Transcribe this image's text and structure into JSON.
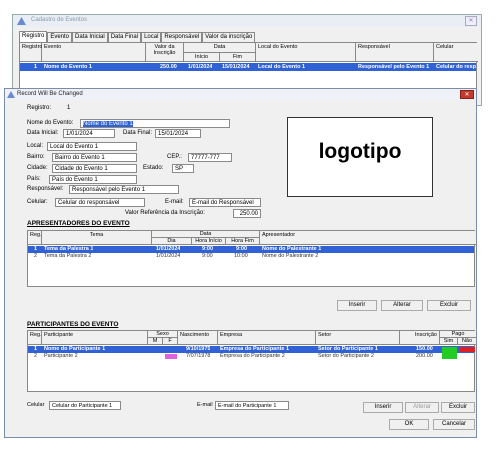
{
  "back_window": {
    "title": "Cadastro de Eventos",
    "tabs": [
      "Registro",
      "Evento",
      "Data Inicial",
      "Data Final",
      "Local",
      "Responsável",
      "Valor da inscrição"
    ],
    "columns": {
      "registro": "Registro",
      "evento": "Evento",
      "valor": "Valor da Inscrição",
      "data": "Data",
      "inicio": "Início",
      "fim": "Fim",
      "local": "Local do Evento",
      "responsavel": "Responsável",
      "celular": "Celular"
    },
    "row": {
      "registro": "1",
      "evento": "Nome do Evento 1",
      "valor": "250.00",
      "inicio": "1/01/2024",
      "fim": "15/01/2024",
      "local": "Local do Evento 1",
      "responsavel": "Responsável pelo Evento 1",
      "celular": "Celular do resp"
    }
  },
  "dialog": {
    "title": "Record Will Be Changed",
    "registro": {
      "label": "Registro:",
      "value": "1"
    },
    "nome": {
      "label": "Nome do Evento:",
      "value": "Nome do Evento 1"
    },
    "data_inicial": {
      "label": "Data Inicial:",
      "value": "1/01/2024"
    },
    "data_final": {
      "label": "Data Final:",
      "value": "15/01/2024"
    },
    "local": {
      "label": "Local:",
      "value": "Local do Evento 1"
    },
    "bairro": {
      "label": "Bairro:",
      "value": "Bairro do Evento 1"
    },
    "cep": {
      "label": "CEP.:",
      "value": "77777-777"
    },
    "cidade": {
      "label": "Cidade:",
      "value": "Cidade do Evento 1"
    },
    "estado": {
      "label": "Estado:",
      "value": "SP"
    },
    "pais": {
      "label": "País:",
      "value": "País do Evento 1"
    },
    "responsavel": {
      "label": "Responsável:",
      "value": "Responsável pelo Evento 1"
    },
    "celular": {
      "label": "Celular:",
      "value": "Celular do responsável"
    },
    "email": {
      "label": "E-mail:",
      "value": "E-mail do Responsável"
    },
    "valor_ref": {
      "label": "Valor Referência da Inscrição:",
      "value": "250.00"
    },
    "logo": "logotipo",
    "apresentadores": {
      "title": "APRESENTADORES DO EVENTO",
      "columns": {
        "reg": "Reg.",
        "tema": "Tema",
        "data": "Data",
        "dia": "Dia",
        "hora_inicio": "Hora Início",
        "hora_fim": "Hora Fim",
        "apresentador": "Apresentador"
      },
      "rows": [
        {
          "reg": "1",
          "tema": "Tema da Palestra 1",
          "dia": "1/01/2024",
          "inicio": "9:00",
          "fim": "9:00",
          "apresentador": "Nome do Palestrante 1"
        },
        {
          "reg": "2",
          "tema": "Tema da Palestra 2",
          "dia": "1/01/2024",
          "inicio": "9:00",
          "fim": "10:00",
          "apresentador": "Nome do Palestrante 2"
        }
      ],
      "buttons": {
        "inserir": "Inserir",
        "alterar": "Alterar",
        "excluir": "Excluir"
      }
    },
    "participantes": {
      "title": "PARTICIPANTES DO EVENTO",
      "columns": {
        "reg": "Reg.",
        "participante": "Participante",
        "sexo": "Sexo",
        "m": "M",
        "f": "F",
        "nascimento": "Nascimento",
        "empresa": "Empresa",
        "setor": "Setor",
        "inscricao": "Inscrição",
        "pago": "Pago",
        "sim": "Sim",
        "nao": "Não"
      },
      "rows": [
        {
          "reg": "1",
          "participante": "Nome do Participante 1",
          "nascimento": "9/10/1975",
          "empresa": "Empresa do Participante 1",
          "setor": "Setor do Participante 1",
          "inscricao": "150.00"
        },
        {
          "reg": "2",
          "participante": "Participante 2",
          "nascimento": "7/07/1978",
          "empresa": "Empresa do Participante 2",
          "setor": "Setor do Participante 2",
          "inscricao": "200.00"
        }
      ],
      "celular_label": "Celular",
      "celular_value": "Celular do Participante 1",
      "email_label": "E-mail",
      "email_value": "E-mail do Participante 1",
      "buttons": {
        "inserir": "Inserir",
        "alterar": "Alterar",
        "excluir": "Excluir"
      }
    },
    "ok": "OK",
    "cancelar": "Cancelar"
  },
  "colors": {
    "selection": "#3062d6",
    "sexo_f": "#e060e0",
    "pago_sim": "#22cc22",
    "pago_nao": "#e02020",
    "close_btn": "#c43a2c"
  }
}
